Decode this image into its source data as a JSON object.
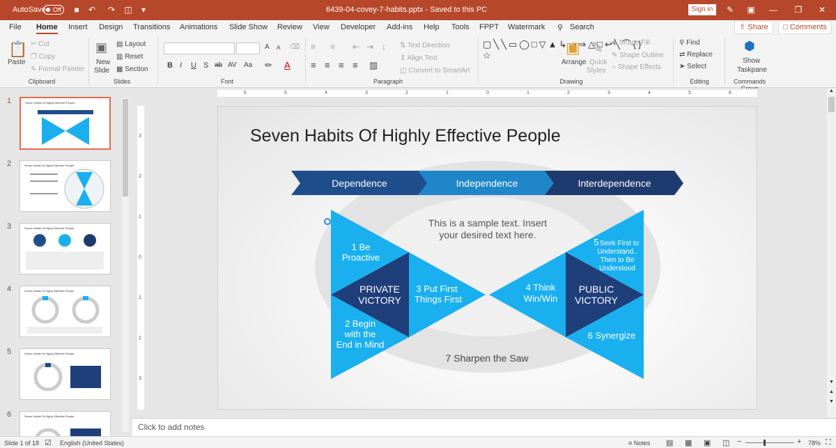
{
  "titlebar": {
    "autosave": "AutoSave",
    "autosave_state": "Off",
    "title": "6439-04-covey-7-habits.pptx  -  Saved to this PC",
    "signin": "Sign in"
  },
  "tabs": [
    "File",
    "Home",
    "Insert",
    "Design",
    "Transitions",
    "Animations",
    "Slide Show",
    "Review",
    "View",
    "Developer",
    "Add-ins",
    "Help",
    "Tools",
    "FPPT",
    "Watermark",
    "Search"
  ],
  "share": "Share",
  "comments": "Comments",
  "ribbon": {
    "clipboard": {
      "paste": "Paste",
      "cut": "Cut",
      "copy": "Copy",
      "format_painter": "Format Painter",
      "label": "Clipboard"
    },
    "slides": {
      "new_slide_1": "New",
      "new_slide_2": "Slide",
      "layout": "Layout",
      "reset": "Reset",
      "section": "Section",
      "label": "Slides"
    },
    "font": {
      "label": "Font",
      "bold": "B",
      "italic": "I",
      "underline": "U",
      "shadow": "S",
      "strike": "ab",
      "spacing": "AV",
      "case": "Aa",
      "grow": "A",
      "shrink": "A"
    },
    "paragraph": {
      "label": "Paragraph",
      "text_direction": "Text Direction",
      "align_text": "Align Text",
      "smartart": "Convert to SmartArt"
    },
    "drawing": {
      "label": "Drawing",
      "arrange": "Arrange",
      "quick1": "Quick",
      "quick2": "Styles",
      "shape_fill": "Shape Fill",
      "shape_outline": "Shape Outline",
      "shape_effects": "Shape Effects"
    },
    "editing": {
      "label": "Editing",
      "find": "Find",
      "replace": "Replace",
      "select": "Select"
    },
    "commands": {
      "label": "Commands Group",
      "show1": "Show",
      "show2": "Taskpane"
    }
  },
  "ruler_h": [
    "6",
    "5",
    "4",
    "3",
    "2",
    "1",
    "0",
    "1",
    "2",
    "3",
    "4",
    "5",
    "6"
  ],
  "ruler_v": [
    "3",
    "2",
    "1",
    "0",
    "1",
    "2",
    "3"
  ],
  "thumbs": [
    {
      "num": "1",
      "title": "Seven Habits Of Highly Effective People"
    },
    {
      "num": "2",
      "title": "Seven Habits Of Highly Effective People"
    },
    {
      "num": "3",
      "title": "Seven Habits Of Highly Effective People"
    },
    {
      "num": "4",
      "title": "Seven Habits Of Highly Effective People"
    },
    {
      "num": "5",
      "title": "Seven Habits Of Highly Effective People"
    },
    {
      "num": "6",
      "title": "Seven Habits Of Highly Effective People"
    }
  ],
  "slide": {
    "title": "Seven Habits Of Highly Effective People",
    "arrows": [
      "Dependence",
      "Independence",
      "Interdependence"
    ],
    "sample_1": "This is a sample text. Insert",
    "sample_2": "your desired text here.",
    "h1a": "1 Be",
    "h1b": "Proactive",
    "h2a": "2 Begin",
    "h2b": "with the",
    "h2c": "End in Mind",
    "h3a": "3 Put First",
    "h3b": "Things First",
    "pv1": "PRIVATE",
    "pv2": "VICTORY",
    "h4a": "4 Think",
    "h4b": "Win/Win",
    "pu1": "PUBLIC",
    "pu2": "VICTORY",
    "h5a": "5",
    "h5b": "Seek First to",
    "h5c": "Understand..",
    "h5d": "Then to Be",
    "h5e": "Understood",
    "h6": "6 Synergize",
    "h7": "7 Sharpen the Saw"
  },
  "notes": "Click to add notes",
  "status": {
    "slide": "Slide 1 of 18",
    "lang": "English (United States)",
    "notes": "Notes",
    "zoom": "78%"
  },
  "colors": {
    "accent": "#b7472a",
    "dark_blue": "#1f4e8c",
    "light_blue": "#1ab0ef",
    "navy": "#1e3a6e"
  }
}
